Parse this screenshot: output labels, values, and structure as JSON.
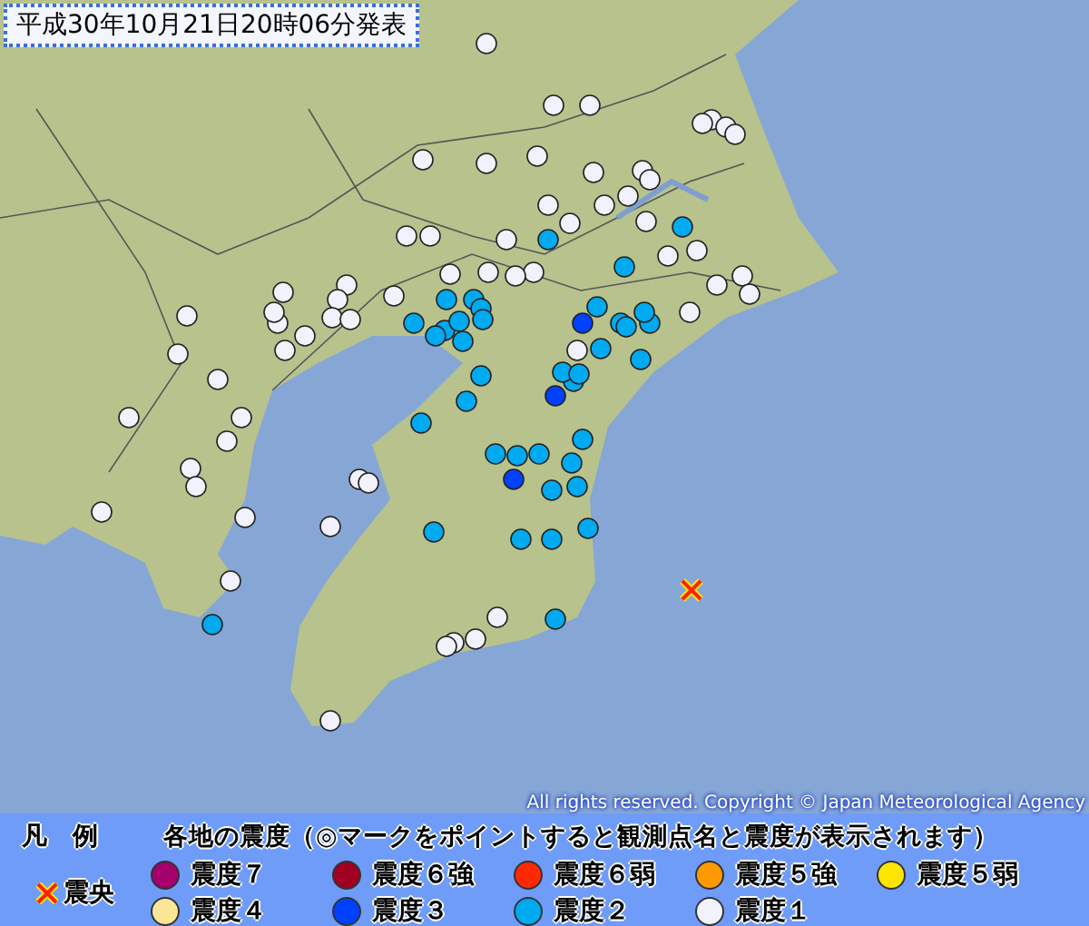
{
  "title": "平成30年10月21日20時06分発表",
  "copyright": "All rights reserved. Copyright © Japan Meteorological Agency",
  "legend": {
    "label": "凡　例",
    "heading": "各地の震度（◎マークをポイントすると観測点名と震度が表示されます）",
    "epicenter": {
      "label": "震央"
    },
    "items": [
      {
        "label": "震度７",
        "color": "#a5006e"
      },
      {
        "label": "震度６強",
        "color": "#a00021"
      },
      {
        "label": "震度６弱",
        "color": "#ff2800"
      },
      {
        "label": "震度５強",
        "color": "#ff9900"
      },
      {
        "label": "震度５弱",
        "color": "#ffe600"
      },
      {
        "label": "震度４",
        "color": "#fae696"
      },
      {
        "label": "震度３",
        "color": "#0041ff"
      },
      {
        "label": "震度２",
        "color": "#00aaf0"
      },
      {
        "label": "震度１",
        "color": "#f2f2ff"
      }
    ]
  }
}
